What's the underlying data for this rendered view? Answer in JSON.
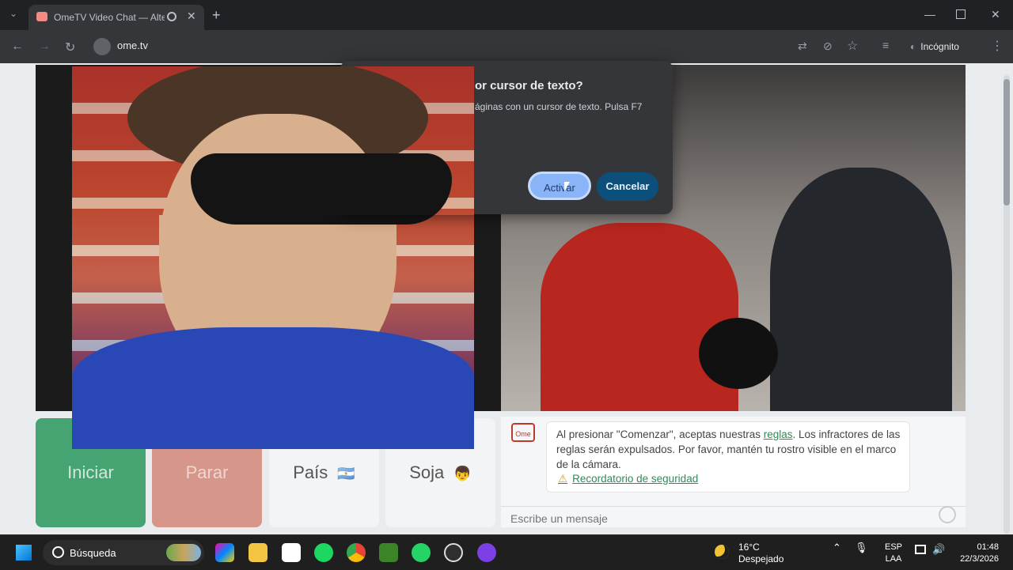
{
  "browser": {
    "tab_title": "OmeTV Video Chat — Alter",
    "url": "ome.tv",
    "incognito_label": "Incógnito",
    "new_tab_symbol": "+",
    "close_symbol": "✕"
  },
  "dialog": {
    "title": "or cursor de texto?",
    "body": "áginas con un cursor de texto. Pulsa F7",
    "activate_label": "Activar",
    "cancel_label": "Cancelar"
  },
  "controls": {
    "start_label": "Iniciar",
    "stop_label": "Parar",
    "country_label": "País",
    "country_flag": "🇦🇷",
    "gender_label": "Soja",
    "gender_emoji": "👦"
  },
  "chat": {
    "logo_text": "Ome",
    "notice_prefix": "Al presionar \"Comenzar\", aceptas nuestras ",
    "rules_link": "reglas",
    "notice_suffix": ". Los infractores de las reglas serán expulsados. Por favor, mantén tu rostro visible en el marco de la cámara.",
    "safety_link": "Recordatorio de seguridad",
    "input_placeholder": "Escribe un mensaje"
  },
  "taskbar": {
    "search_label": "Búsqueda",
    "weather_temp": "16°C",
    "weather_condition": "Despejado",
    "lang_top": "ESP",
    "lang_bottom": "LAA",
    "time": "01:48",
    "date": "22/3/2026",
    "apps": [
      "copilot-icon",
      "file-explorer-icon",
      "store-icon",
      "spotify-icon",
      "chrome-icon",
      "minecraft-icon",
      "whatsapp-icon",
      "obs-icon",
      "app-icon"
    ]
  }
}
